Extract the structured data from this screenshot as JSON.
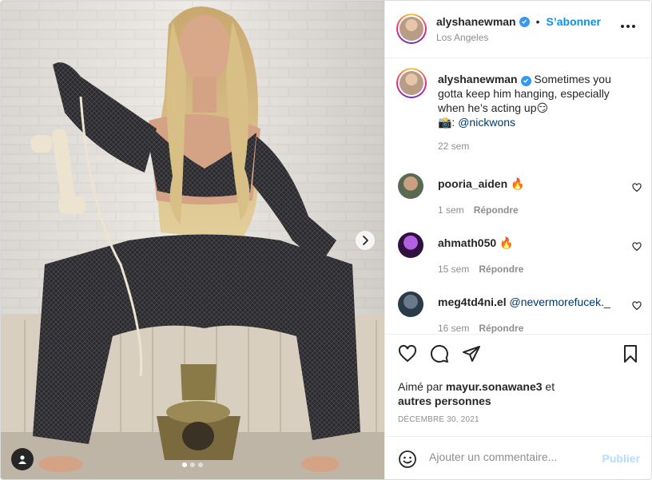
{
  "post": {
    "username": "alyshanewman",
    "follow_label": "S’abonner",
    "separator": "•",
    "location": "Los Angeles",
    "caption_text": "Sometimes you gotta keep him hanging, especially when he’s acting up😏",
    "caption_credit_prefix": "📸: ",
    "caption_mention": "@nickwons",
    "caption_time": "22 sem",
    "likes_prefix": "Aimé par ",
    "likes_user": "mayur.sonawane3",
    "likes_suffix": " et",
    "likes_others": "autres personnes",
    "date": "DÉCEMBRE 30, 2021"
  },
  "comments": [
    {
      "username": "pooria_aiden",
      "text": "🔥",
      "mention": "",
      "time": "1 sem",
      "reply_label": "Répondre"
    },
    {
      "username": "ahmath050",
      "text": "🔥",
      "mention": "",
      "time": "15 sem",
      "reply_label": "Répondre"
    },
    {
      "username": "meg4td4ni.el",
      "text": "",
      "mention": "@nevermorefucek._",
      "time": "16 sem",
      "reply_label": "Répondre"
    }
  ],
  "add_comment": {
    "placeholder": "Ajouter un commentaire...",
    "publish_label": "Publier"
  },
  "carousel": {
    "slides": 3,
    "active_index": 0
  },
  "icons": {
    "verified": "verified-badge-icon",
    "more": "more-options-icon",
    "like": "heart-icon",
    "comment": "comment-icon",
    "share": "send-icon",
    "save": "bookmark-icon",
    "emoji": "emoji-icon",
    "next": "chevron-right-icon",
    "tag": "user-tag-icon"
  },
  "colors": {
    "accent": "#0095f6",
    "publish_disabled": "#b2dffc",
    "muted": "#8e8e8e",
    "text": "#262626",
    "mention": "#00376b"
  }
}
